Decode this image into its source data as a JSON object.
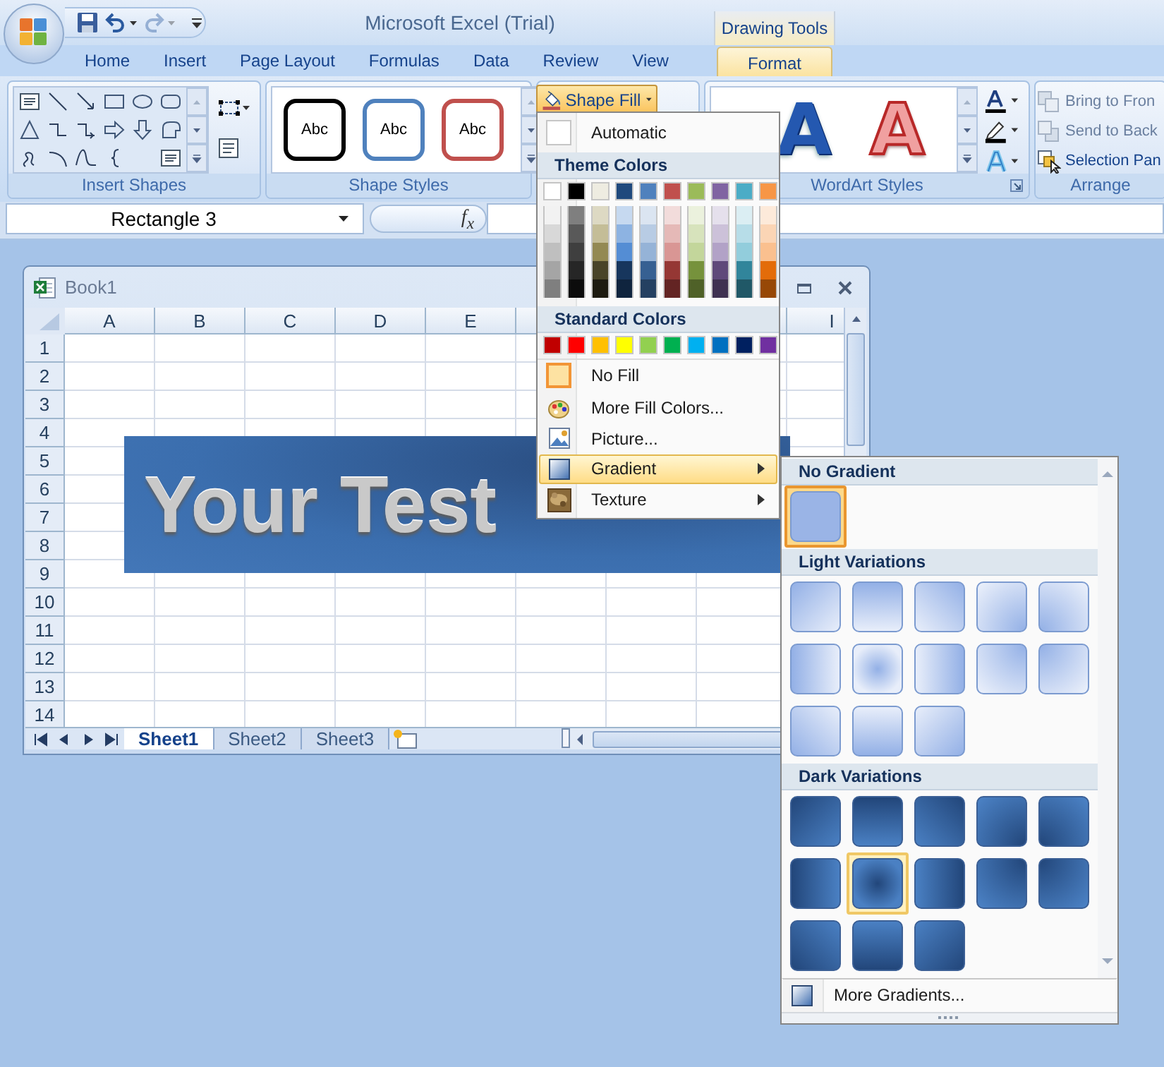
{
  "app": {
    "title": "Microsoft Excel (Trial)",
    "context_label": "Drawing Tools"
  },
  "quick_access": {
    "redo": {
      "disabled": true
    }
  },
  "tabs": [
    {
      "label": "Home",
      "selected": false,
      "contextual": false
    },
    {
      "label": "Insert",
      "selected": false,
      "contextual": false
    },
    {
      "label": "Page Layout",
      "selected": false,
      "contextual": false
    },
    {
      "label": "Formulas",
      "selected": false,
      "contextual": false
    },
    {
      "label": "Data",
      "selected": false,
      "contextual": false
    },
    {
      "label": "Review",
      "selected": false,
      "contextual": false
    },
    {
      "label": "View",
      "selected": false,
      "contextual": false
    },
    {
      "label": "Format",
      "selected": true,
      "contextual": true
    }
  ],
  "insert_shapes": {
    "label": "Insert Shapes"
  },
  "shape_styles": {
    "label": "Shape Styles",
    "samples": [
      {
        "text": "Abc",
        "color": "#000000"
      },
      {
        "text": "Abc",
        "color": "#4f81bd"
      },
      {
        "text": "Abc",
        "color": "#c0504d"
      }
    ]
  },
  "shape_fill_button": {
    "label": "Shape Fill",
    "open": true
  },
  "wordart_styles": {
    "label": "WordArt Styles",
    "samples": [
      {
        "text": "A",
        "kind": "blue-bevel"
      },
      {
        "text": "A",
        "kind": "red-outline"
      }
    ]
  },
  "arrange": {
    "label": "Arrange",
    "commands": [
      {
        "label": "Bring to Fron",
        "disabled": true
      },
      {
        "label": "Send to Back",
        "disabled": true
      },
      {
        "label": "Selection Pan",
        "disabled": false
      }
    ]
  },
  "formula_bar": {
    "name_box": "Rectangle 3",
    "function_label": "f$_{x}$"
  },
  "workbook": {
    "title": "Book1",
    "columns": [
      {
        "label": "A"
      },
      {
        "label": "B"
      },
      {
        "label": "C"
      },
      {
        "label": "D"
      },
      {
        "label": "E"
      },
      {},
      {},
      {},
      {
        "label": "I"
      }
    ],
    "rows": [
      "1",
      "2",
      "3",
      "4",
      "5",
      "6",
      "7",
      "8",
      "9",
      "10",
      "11",
      "12",
      "13",
      "14"
    ],
    "shape_text": "Your Test",
    "sheets": [
      {
        "label": "Sheet1",
        "selected": true
      },
      {
        "label": "Sheet2",
        "selected": false
      },
      {
        "label": "Sheet3",
        "selected": false
      }
    ]
  },
  "shape_fill_menu": {
    "entries": [
      {
        "kind": "swatch-item",
        "label": "Automatic",
        "selected": false,
        "highlighted": false
      },
      {
        "kind": "header",
        "label": "Theme Colors"
      },
      {
        "kind": "theme-grid",
        "colors": [
          {
            "color": "#ffffff",
            "shades": [
              {
                "color": "#f2f2f2"
              },
              {
                "color": "#d8d8d8"
              },
              {
                "color": "#bfbfbf"
              },
              {
                "color": "#a5a5a5"
              },
              {
                "color": "#7f7f7f"
              }
            ]
          },
          {
            "color": "#000000",
            "shades": [
              {
                "color": "#7f7f7f"
              },
              {
                "color": "#595959"
              },
              {
                "color": "#3f3f3f"
              },
              {
                "color": "#262626"
              },
              {
                "color": "#0c0c0c"
              }
            ]
          },
          {
            "color": "#eeece1",
            "shades": [
              {
                "color": "#ddd9c3"
              },
              {
                "color": "#c4bd97"
              },
              {
                "color": "#938953"
              },
              {
                "color": "#494429"
              },
              {
                "color": "#1d1b10"
              }
            ]
          },
          {
            "color": "#1f497d",
            "shades": [
              {
                "color": "#c6d9f0"
              },
              {
                "color": "#8db3e2"
              },
              {
                "color": "#548dd4"
              },
              {
                "color": "#17365d"
              },
              {
                "color": "#0f243e"
              }
            ]
          },
          {
            "color": "#4f81bd",
            "shades": [
              {
                "color": "#dbe5f1"
              },
              {
                "color": "#b8cce4"
              },
              {
                "color": "#95b3d7"
              },
              {
                "color": "#366092"
              },
              {
                "color": "#244061"
              }
            ]
          },
          {
            "color": "#c0504d",
            "shades": [
              {
                "color": "#f2dcdb"
              },
              {
                "color": "#e5b9b7"
              },
              {
                "color": "#d99694"
              },
              {
                "color": "#953734"
              },
              {
                "color": "#632423"
              }
            ]
          },
          {
            "color": "#9bbb59",
            "shades": [
              {
                "color": "#ebf1dd"
              },
              {
                "color": "#d7e3bc"
              },
              {
                "color": "#c3d69b"
              },
              {
                "color": "#76923c"
              },
              {
                "color": "#4f6128"
              }
            ]
          },
          {
            "color": "#8064a2",
            "shades": [
              {
                "color": "#e5e0ec"
              },
              {
                "color": "#ccc1d9"
              },
              {
                "color": "#b2a2c7"
              },
              {
                "color": "#5f497a"
              },
              {
                "color": "#3f3151"
              }
            ]
          },
          {
            "color": "#4bacc6",
            "shades": [
              {
                "color": "#dbeef3"
              },
              {
                "color": "#b7dde8"
              },
              {
                "color": "#92cddc"
              },
              {
                "color": "#31859b"
              },
              {
                "color": "#205867"
              }
            ]
          },
          {
            "color": "#f79646",
            "shades": [
              {
                "color": "#fdeada"
              },
              {
                "color": "#fbd5b5"
              },
              {
                "color": "#fac08f"
              },
              {
                "color": "#e36c09"
              },
              {
                "color": "#974806"
              }
            ]
          }
        ]
      },
      {
        "kind": "header",
        "label": "Standard Colors"
      },
      {
        "kind": "color-row",
        "colors": [
          {
            "color": "#c00000"
          },
          {
            "color": "#ff0000"
          },
          {
            "color": "#ffc000"
          },
          {
            "color": "#ffff00"
          },
          {
            "color": "#92d050"
          },
          {
            "color": "#00b050"
          },
          {
            "color": "#00b0f0"
          },
          {
            "color": "#0070c0"
          },
          {
            "color": "#002060"
          },
          {
            "color": "#7030a0"
          }
        ]
      },
      {
        "kind": "swatch-item",
        "label": "No Fill",
        "selected": true,
        "highlighted": false
      },
      {
        "kind": "command",
        "label": "More Fill Colors...",
        "highlighted": false
      },
      {
        "kind": "command",
        "label": "Picture...",
        "highlighted": false
      },
      {
        "kind": "submenu",
        "label": "Gradient",
        "highlighted": true
      },
      {
        "kind": "submenu",
        "label": "Texture",
        "highlighted": false
      }
    ]
  },
  "gradient_menu": {
    "sections": [
      {
        "title": "No Gradient",
        "kind": "none",
        "swatches": [
          {
            "kind": "flat",
            "selected": true,
            "highlighted": false
          }
        ]
      },
      {
        "title": "Light Variations",
        "kind": "light",
        "swatches": [
          {
            "kind": "diag-se",
            "selected": false,
            "highlighted": false
          },
          {
            "kind": "down",
            "selected": false,
            "highlighted": false
          },
          {
            "kind": "diag-sw",
            "selected": false,
            "highlighted": false
          },
          {
            "kind": "corner-br",
            "selected": false,
            "highlighted": false
          },
          {
            "kind": "corner-bl",
            "selected": false,
            "highlighted": false
          },
          {
            "kind": "right",
            "selected": false,
            "highlighted": false
          },
          {
            "kind": "center",
            "selected": false,
            "highlighted": false
          },
          {
            "kind": "left",
            "selected": false,
            "highlighted": false
          },
          {
            "kind": "corner-tr",
            "selected": false,
            "highlighted": false
          },
          {
            "kind": "corner-tl",
            "selected": false,
            "highlighted": false
          },
          {
            "kind": "diag-ne",
            "selected": false,
            "highlighted": false
          },
          {
            "kind": "up",
            "selected": false,
            "highlighted": false
          },
          {
            "kind": "diag-nw",
            "selected": false,
            "highlighted": false
          }
        ]
      },
      {
        "title": "Dark Variations",
        "kind": "dark",
        "swatches": [
          {
            "kind": "diag-se",
            "selected": false,
            "highlighted": false
          },
          {
            "kind": "down",
            "selected": false,
            "highlighted": false
          },
          {
            "kind": "diag-sw",
            "selected": false,
            "highlighted": false
          },
          {
            "kind": "corner-br",
            "selected": false,
            "highlighted": false
          },
          {
            "kind": "corner-bl",
            "selected": false,
            "highlighted": false
          },
          {
            "kind": "right",
            "selected": false,
            "highlighted": false
          },
          {
            "kind": "center",
            "selected": false,
            "highlighted": true
          },
          {
            "kind": "left",
            "selected": false,
            "highlighted": false
          },
          {
            "kind": "corner-tr",
            "selected": false,
            "highlighted": false
          },
          {
            "kind": "corner-tl",
            "selected": false,
            "highlighted": false
          },
          {
            "kind": "diag-ne",
            "selected": false,
            "highlighted": false
          },
          {
            "kind": "up",
            "selected": false,
            "highlighted": false
          },
          {
            "kind": "diag-nw",
            "selected": false,
            "highlighted": false
          }
        ]
      }
    ],
    "footer": "More Gradients..."
  }
}
